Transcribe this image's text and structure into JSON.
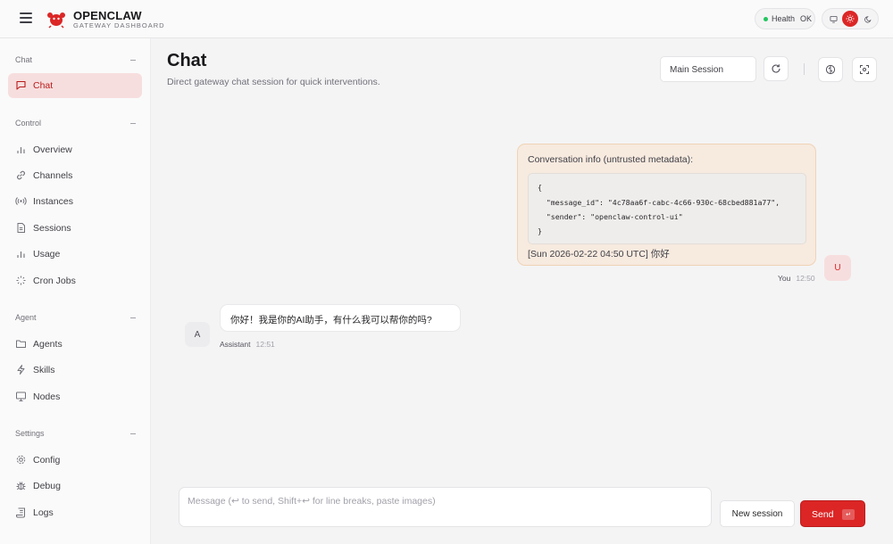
{
  "app": {
    "title": "OPENCLAW",
    "subtitle": "GATEWAY DASHBOARD"
  },
  "health": {
    "label": "Health",
    "value": "OK"
  },
  "sidebar": {
    "sections": [
      {
        "label": "Chat",
        "items": [
          {
            "label": "Chat",
            "icon": "message-square-icon",
            "active": true
          }
        ]
      },
      {
        "label": "Control",
        "items": [
          {
            "label": "Overview",
            "icon": "bar-chart-icon"
          },
          {
            "label": "Channels",
            "icon": "link-icon"
          },
          {
            "label": "Instances",
            "icon": "radio-icon"
          },
          {
            "label": "Sessions",
            "icon": "file-text-icon"
          },
          {
            "label": "Usage",
            "icon": "bar-chart-icon"
          },
          {
            "label": "Cron Jobs",
            "icon": "loader-icon"
          }
        ]
      },
      {
        "label": "Agent",
        "items": [
          {
            "label": "Agents",
            "icon": "folder-icon"
          },
          {
            "label": "Skills",
            "icon": "zap-icon"
          },
          {
            "label": "Nodes",
            "icon": "monitor-icon"
          }
        ]
      },
      {
        "label": "Settings",
        "items": [
          {
            "label": "Config",
            "icon": "gear-icon"
          },
          {
            "label": "Debug",
            "icon": "bug-icon"
          },
          {
            "label": "Logs",
            "icon": "scroll-icon"
          }
        ]
      }
    ]
  },
  "page": {
    "title": "Chat",
    "subtitle": "Direct gateway chat session for quick interventions."
  },
  "toolbar": {
    "session_value": "Main Session"
  },
  "messages": {
    "user": {
      "header": "Conversation info (untrusted metadata):",
      "code": [
        "{",
        "  \"message_id\": \"4c78aa6f-cabc-4c66-930c-68cbed881a77\",",
        "  \"sender\": \"openclaw-control-ui\"",
        "}"
      ],
      "footer": "[Sun 2026-02-22 04:50 UTC] 你好",
      "author": "You",
      "time": "12:50",
      "avatar": "U"
    },
    "assistant": {
      "text": "你好！我是你的AI助手，有什么我可以帮你的吗?",
      "author": "Assistant",
      "time": "12:51",
      "avatar": "A"
    }
  },
  "compose": {
    "placeholder": "Message (↩ to send, Shift+↩ for line breaks, paste images)",
    "new_session_label": "New session",
    "send_label": "Send",
    "send_key": "↵"
  },
  "colors": {
    "accent": "#dc2626",
    "health_dot": "#22c55e"
  }
}
